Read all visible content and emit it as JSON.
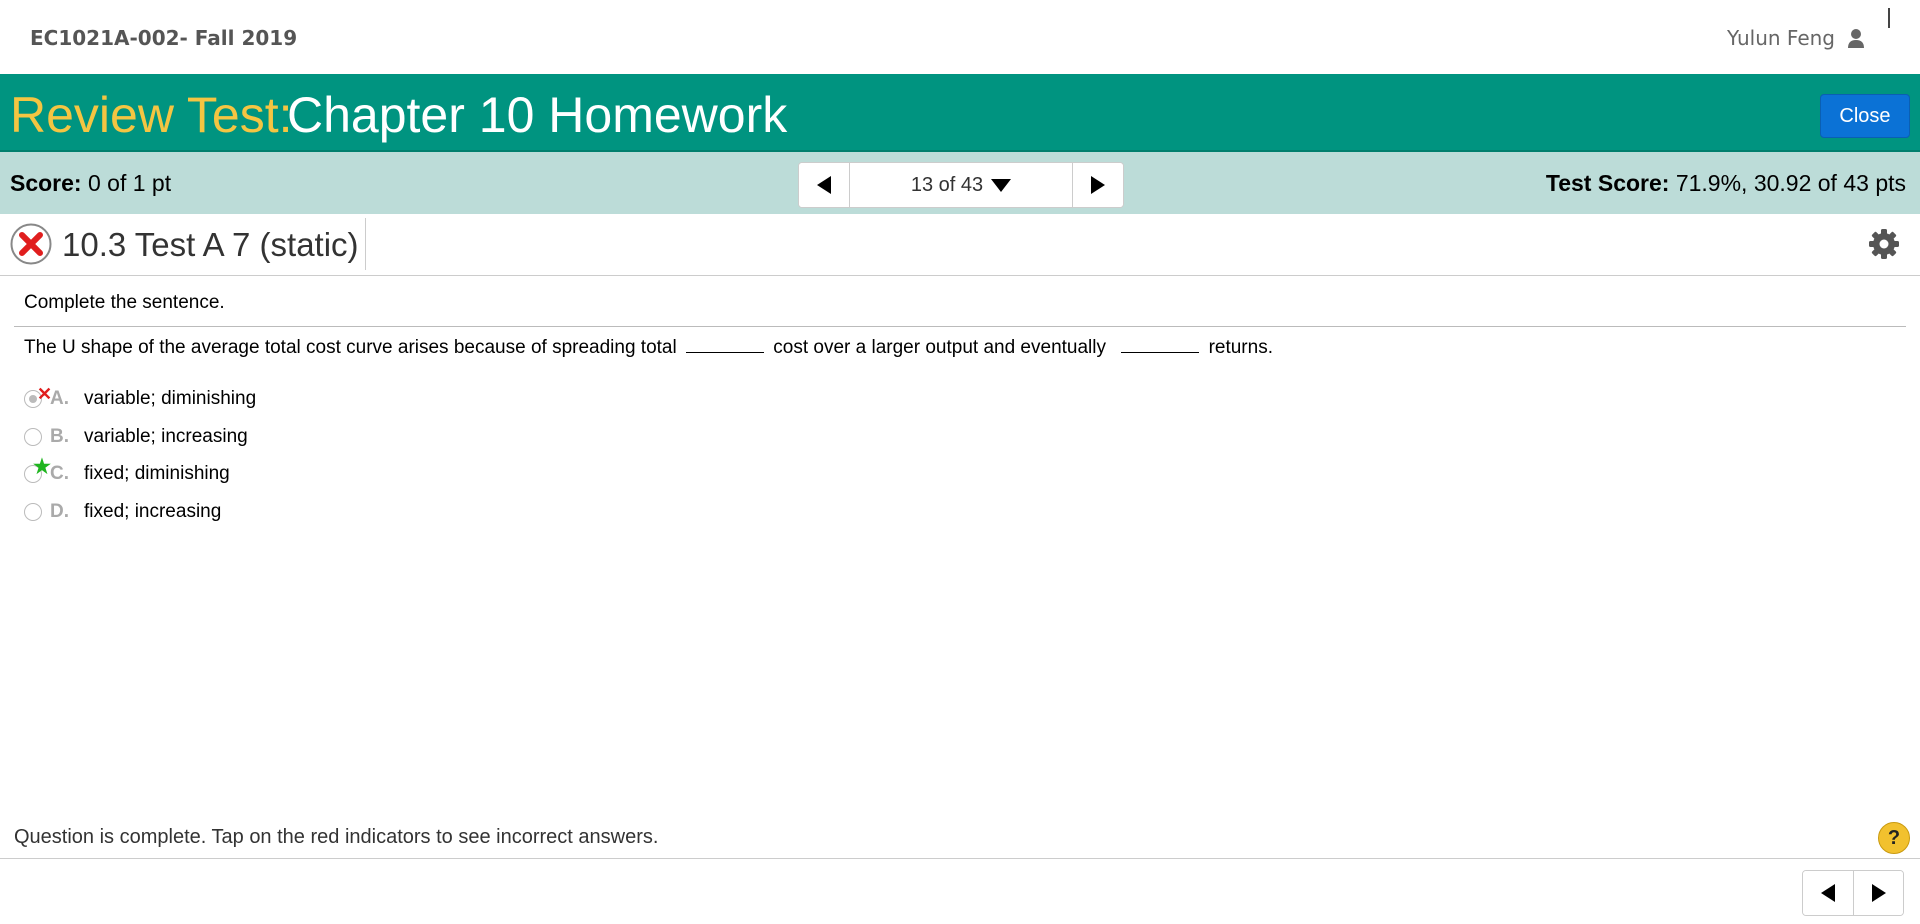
{
  "header": {
    "course": "EC1021A-002- Fall 2019",
    "user": "Yulun Feng"
  },
  "title": {
    "prefix": "Review Test:",
    "main": "Chapter 10 Homework",
    "close_label": "Close"
  },
  "scorebar": {
    "score_label": "Score:",
    "score_value": "0 of 1 pt",
    "position": "13 of 43",
    "test_score_label": "Test Score:",
    "test_score_value": "71.9%, 30.92 of 43 pts"
  },
  "question": {
    "title": "10.3 Test A 7 (static)",
    "instruction": "Complete the sentence.",
    "text_part1": "The U shape of the average total cost curve arises because of spreading total",
    "text_part2": "cost over a larger output and eventually",
    "text_part3": "returns.",
    "options": [
      {
        "letter": "A.",
        "text": "variable; diminishing",
        "selected": true,
        "indicator": "incorrect-x"
      },
      {
        "letter": "B.",
        "text": "variable; increasing",
        "selected": false
      },
      {
        "letter": "C.",
        "text": "fixed; diminishing",
        "selected": false,
        "indicator": "correct-star"
      },
      {
        "letter": "D.",
        "text": "fixed; increasing",
        "selected": false
      }
    ]
  },
  "footer": {
    "message": "Question is complete. Tap on the red indicators to see incorrect answers.",
    "help": "?"
  },
  "colors": {
    "teal": "#009480",
    "gold": "#f4c542",
    "score_bg": "#bcdcd8",
    "button_blue": "#0b72d6",
    "incorrect": "#e01e1e",
    "correct": "#1fb51f"
  }
}
